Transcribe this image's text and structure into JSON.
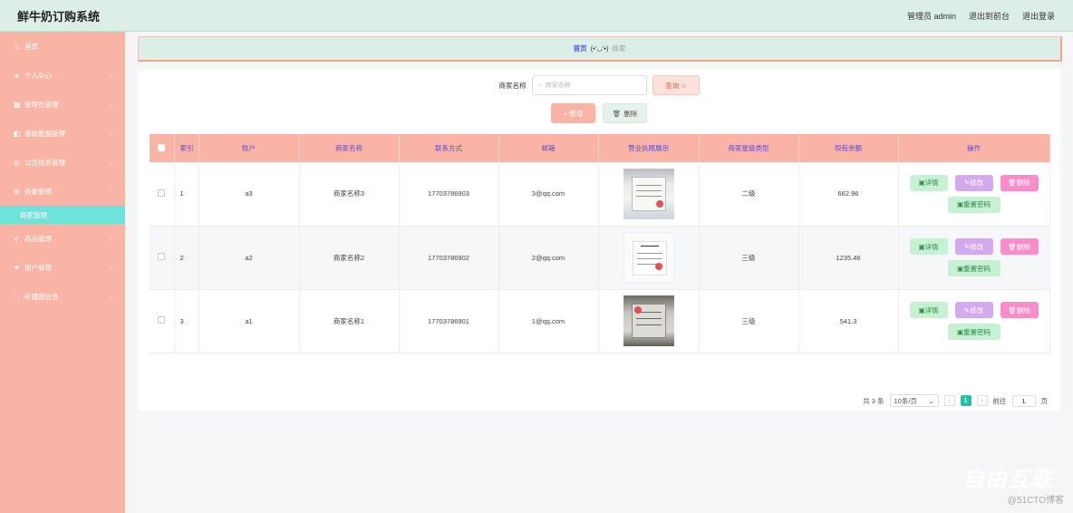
{
  "header": {
    "app_title": "鲜牛奶订购系统",
    "user_label": "管理员 admin",
    "to_front": "退出到前台",
    "logout": "退出登录"
  },
  "sidebar": {
    "items": [
      {
        "label": "首页",
        "icon": "home-icon"
      },
      {
        "label": "个人中心",
        "icon": "user-icon"
      },
      {
        "label": "管理员管理",
        "icon": "admin-icon"
      },
      {
        "label": "基础数据管理",
        "icon": "data-icon"
      },
      {
        "label": "公告信息管理",
        "icon": "notice-icon"
      },
      {
        "label": "商家管理",
        "icon": "grid-icon"
      },
      {
        "label": "商品管理",
        "icon": "goods-icon"
      },
      {
        "label": "用户管理",
        "icon": "users-icon"
      },
      {
        "label": "轮播图信息",
        "icon": "carousel-icon"
      }
    ],
    "active_sub": "商家管理"
  },
  "breadcrumb": {
    "home": "首页",
    "face": "(•'◡'•)",
    "current": "商家"
  },
  "search": {
    "label": "商家名称",
    "placeholder": "商家名称",
    "query_button": "查询"
  },
  "actions": {
    "add": "+ 新增",
    "delete": "删除"
  },
  "table": {
    "headers": [
      "索引",
      "账户",
      "商家名称",
      "联系方式",
      "邮箱",
      "营业执照展示",
      "商家星级类型",
      "现有余额",
      "操作"
    ],
    "rows": [
      {
        "index": "1",
        "account": "a3",
        "name": "商家名称3",
        "phone": "17703786903",
        "email": "3@qq.com",
        "level": "二级",
        "balance": "662.96"
      },
      {
        "index": "2",
        "account": "a2",
        "name": "商家名称2",
        "phone": "17703786902",
        "email": "2@qq.com",
        "level": "三级",
        "balance": "1235.46"
      },
      {
        "index": "3",
        "account": "a1",
        "name": "商家名称1",
        "phone": "17703786901",
        "email": "1@qq.com",
        "level": "三级",
        "balance": "541.3"
      }
    ],
    "ops": {
      "detail": "详情",
      "edit": "修改",
      "delete": "删除",
      "reset": "重置密码"
    }
  },
  "pager": {
    "total": "共 3 条",
    "page_size": "10条/页",
    "current": "1",
    "goto_label": "前往",
    "goto_value": "1",
    "page_suffix": "页"
  },
  "watermark": {
    "logo_text": "自由互联",
    "source": "@51CTO博客"
  },
  "colors": {
    "sidebar_bg": "#f9b4a5",
    "topbar_bg": "#ddeee6",
    "active_sub_bg": "#6de3d9",
    "pager_active": "#2bc0a6"
  }
}
